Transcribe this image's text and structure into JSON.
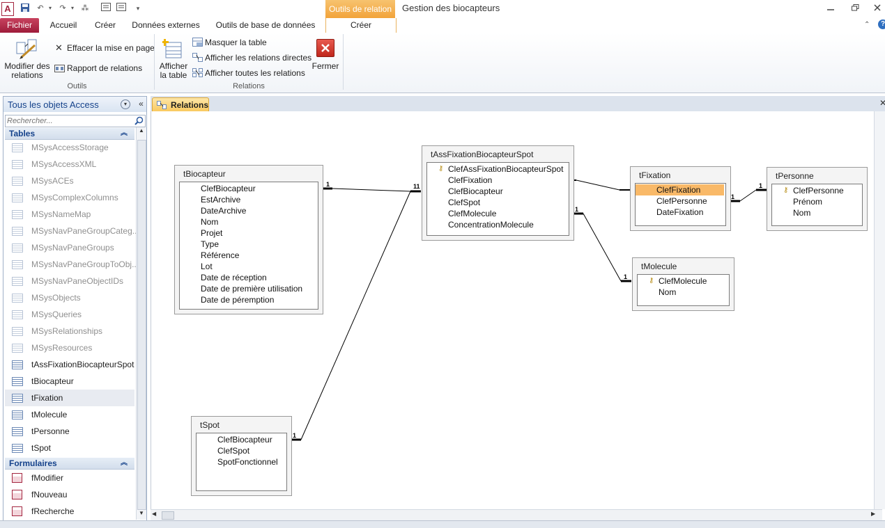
{
  "titlebar": {
    "context_group": "Outils de relation",
    "window_title": "Gestion des biocapteurs"
  },
  "tabs": {
    "fichier": "Fichier",
    "accueil": "Accueil",
    "creer": "Créer",
    "donnees_externes": "Données externes",
    "outils_bd": "Outils de base de données",
    "creer_ctx": "Créer"
  },
  "ribbon": {
    "modifier_relations": [
      "Modifier des",
      "relations"
    ],
    "effacer_mise_en_page": "Effacer la mise en page",
    "rapport_relations": "Rapport de relations",
    "group_outils": "Outils",
    "afficher_table": [
      "Afficher",
      "la table"
    ],
    "masquer_table": "Masquer la table",
    "relations_directes": "Afficher les relations directes",
    "toutes_relations": "Afficher toutes les relations",
    "fermer": "Fermer",
    "group_relations": "Relations"
  },
  "nav": {
    "title": "Tous les objets Access",
    "search_placeholder": "Rechercher...",
    "section_tables": "Tables",
    "section_forms": "Formulaires",
    "tables": [
      "MSysAccessStorage",
      "MSysAccessXML",
      "MSysACEs",
      "MSysComplexColumns",
      "MSysNameMap",
      "MSysNavPaneGroupCateg...",
      "MSysNavPaneGroups",
      "MSysNavPaneGroupToObj...",
      "MSysNavPaneObjectIDs",
      "MSysObjects",
      "MSysQueries",
      "MSysRelationships",
      "MSysResources",
      "tAssFixationBiocapteurSpot",
      "tBiocapteur",
      "tFixation",
      "tMolecule",
      "tPersonne",
      "tSpot"
    ],
    "forms": [
      "fModifier",
      "fNouveau",
      "fRecherche"
    ]
  },
  "doc": {
    "tab_label": "Relations"
  },
  "diagram": {
    "tBiocapteur": {
      "name": "tBiocapteur",
      "fields": [
        "ClefBiocapteur",
        "EstArchive",
        "DateArchive",
        "Nom",
        "Projet",
        "Type",
        "Référence",
        "Lot",
        "Date de réception",
        "Date de première utilisation",
        "Date de péremption"
      ]
    },
    "tAss": {
      "name": "tAssFixationBiocapteurSpot",
      "fields": [
        "ClefAssFixationBiocapteurSpot",
        "ClefFixation",
        "ClefBiocapteur",
        "ClefSpot",
        "ClefMolecule",
        "ConcentrationMolecule"
      ]
    },
    "tFixation": {
      "name": "tFixation",
      "fields": [
        "ClefFixation",
        "ClefPersonne",
        "DateFixation"
      ]
    },
    "tPersonne": {
      "name": "tPersonne",
      "fields": [
        "ClefPersonne",
        "Prénom",
        "Nom"
      ]
    },
    "tMolecule": {
      "name": "tMolecule",
      "fields": [
        "ClefMolecule",
        "Nom"
      ]
    },
    "tSpot": {
      "name": "tSpot",
      "fields": [
        "ClefBiocapteur",
        "ClefSpot",
        "SpotFonctionnel"
      ]
    },
    "cardinality_one": "1"
  }
}
